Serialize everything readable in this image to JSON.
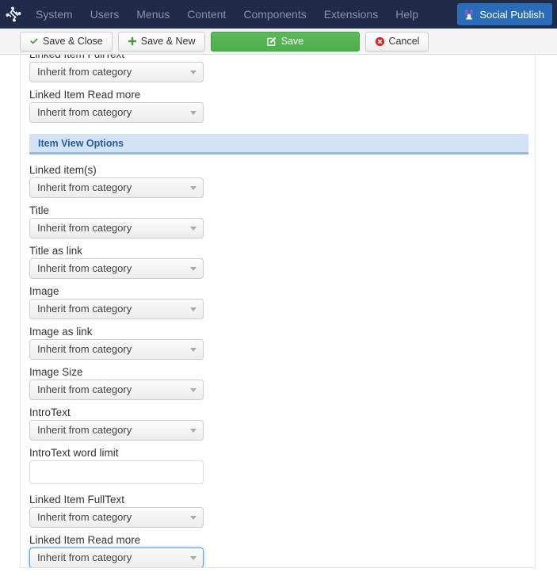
{
  "topnav": {
    "logo_icon": "joomla-logo-icon",
    "items": [
      {
        "label": "System"
      },
      {
        "label": "Users"
      },
      {
        "label": "Menus"
      },
      {
        "label": "Content"
      },
      {
        "label": "Components"
      },
      {
        "label": "Extensions"
      },
      {
        "label": "Help"
      }
    ],
    "social_publish": {
      "label": "Social Publish",
      "icon": "social-publish-icon",
      "bg_color": "#2b6cb8"
    },
    "bg_color": "#1f2b49",
    "text_color": "#8792a6"
  },
  "toolbar": {
    "save_close_label": "Save & Close",
    "save_close_icon": "check-icon",
    "save_new_label": "Save & New",
    "save_new_icon": "plus-icon",
    "save_label": "Save",
    "save_icon": "edit-pencil-icon",
    "save_bg_color": "#5cb85c",
    "cancel_label": "Cancel",
    "cancel_icon": "cancel-circle-icon",
    "cancel_icon_color": "#c9302c"
  },
  "form": {
    "top_partial_fields": [
      {
        "label": "Linked Item FullText",
        "value": "Inherit from category"
      },
      {
        "label": "Linked Item Read more",
        "value": "Inherit from category"
      }
    ],
    "section": {
      "title": "Item View Options",
      "bg_color": "#d3e3f7",
      "text_color": "#2c5d96",
      "border_color": "#9cb6d4"
    },
    "fields": [
      {
        "label": "Linked item(s)",
        "type": "select",
        "value": "Inherit from category",
        "focused": false
      },
      {
        "label": "Title",
        "type": "select",
        "value": "Inherit from category",
        "focused": false
      },
      {
        "label": "Title as link",
        "type": "select",
        "value": "Inherit from category",
        "focused": false
      },
      {
        "label": "Image",
        "type": "select",
        "value": "Inherit from category",
        "focused": false
      },
      {
        "label": "Image as link",
        "type": "select",
        "value": "Inherit from category",
        "focused": false
      },
      {
        "label": "Image Size",
        "type": "select",
        "value": "Inherit from category",
        "focused": false
      },
      {
        "label": "IntroText",
        "type": "select",
        "value": "Inherit from category",
        "focused": false
      },
      {
        "label": "IntroText word limit",
        "type": "text",
        "value": "",
        "placeholder": "",
        "focused": false
      },
      {
        "label": "Linked Item FullText",
        "type": "select",
        "value": "Inherit from category",
        "focused": false
      },
      {
        "label": "Linked Item Read more",
        "type": "select",
        "value": "Inherit from category",
        "focused": true
      }
    ],
    "select_options": [
      "Inherit from category"
    ]
  }
}
